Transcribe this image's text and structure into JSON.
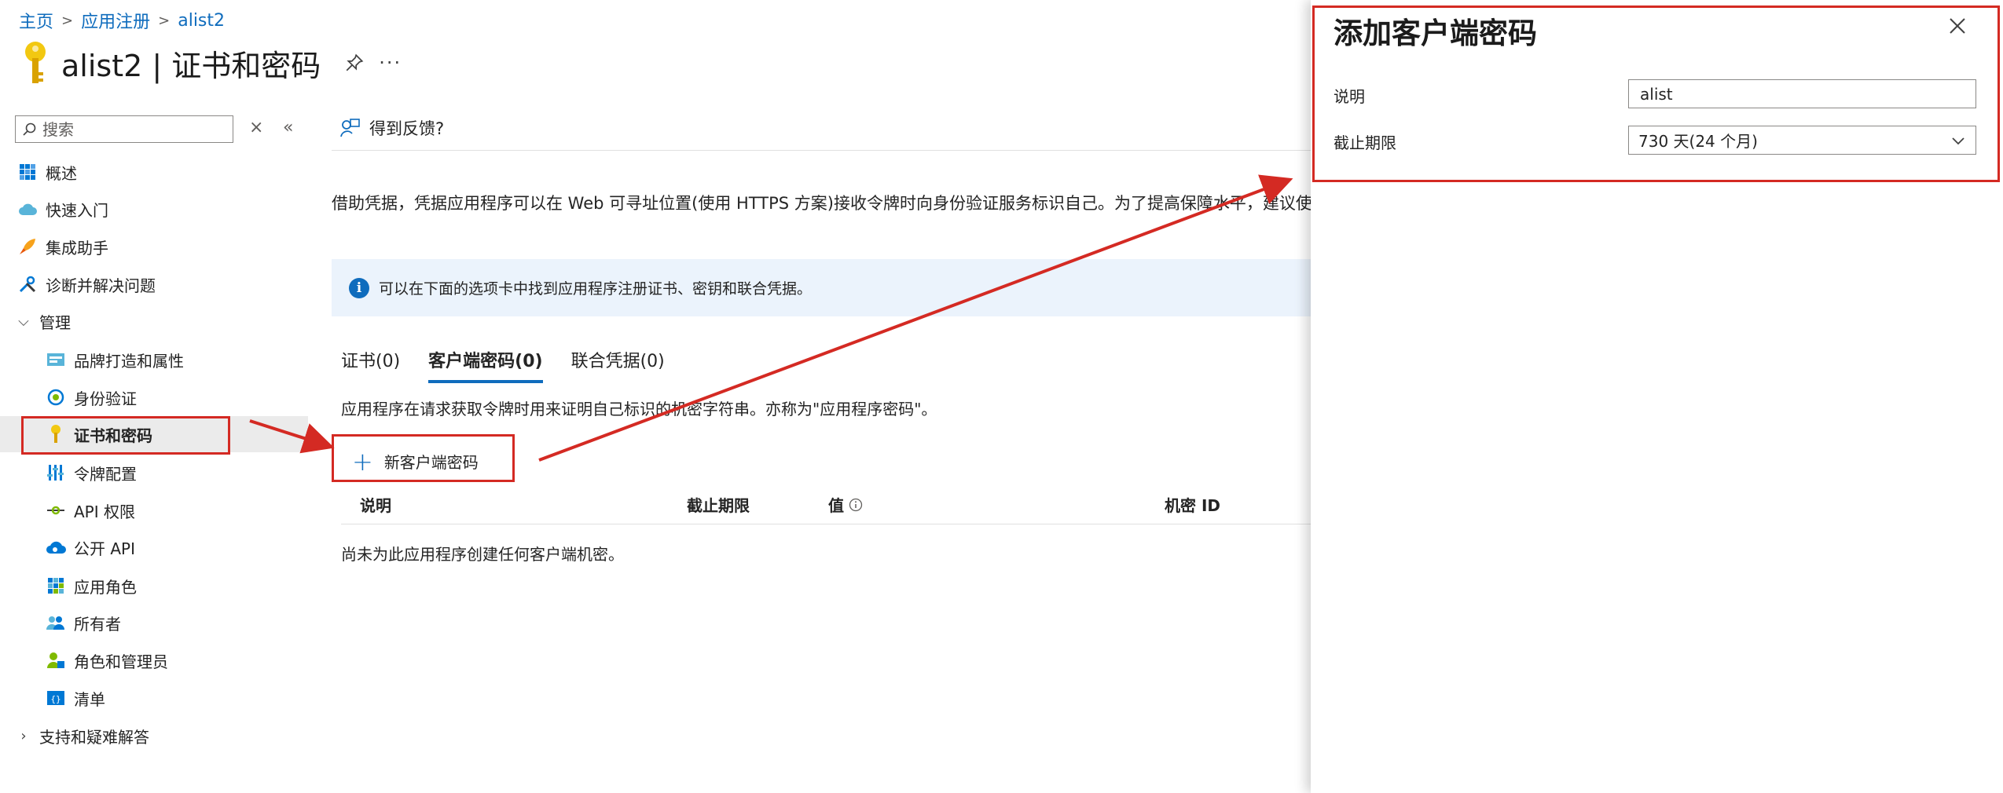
{
  "breadcrumb": [
    "主页",
    "应用注册",
    "alist2"
  ],
  "page": {
    "title": "alist2 | 证书和密码"
  },
  "sidebar": {
    "search_placeholder": "搜索",
    "items": [
      {
        "label": "概述",
        "icon": "grid-icon"
      },
      {
        "label": "快速入门",
        "icon": "cloud-rocket-icon"
      },
      {
        "label": "集成助手",
        "icon": "rocket-icon"
      },
      {
        "label": "诊断并解决问题",
        "icon": "wrench-icon"
      },
      {
        "label": "管理",
        "icon": "chevron-down-icon"
      },
      {
        "label": "品牌打造和属性",
        "icon": "card-icon"
      },
      {
        "label": "身份验证",
        "icon": "auth-icon"
      },
      {
        "label": "证书和密码",
        "icon": "key-icon"
      },
      {
        "label": "令牌配置",
        "icon": "bars-icon"
      },
      {
        "label": "API 权限",
        "icon": "api-icon"
      },
      {
        "label": "公开 API",
        "icon": "cloud-icon"
      },
      {
        "label": "应用角色",
        "icon": "apps-icon"
      },
      {
        "label": "所有者",
        "icon": "people-icon"
      },
      {
        "label": "角色和管理员",
        "icon": "user-admin-icon"
      },
      {
        "label": "清单",
        "icon": "manifest-icon"
      },
      {
        "label": "支持和疑难解答",
        "icon": "chevron-right-icon"
      }
    ]
  },
  "main": {
    "feedback": "得到反馈?",
    "description": "借助凭据，凭据应用程序可以在 Web 可寻址位置(使用 HTTPS 方案)接收令牌时向身份验证服务标识自己。为了提高保障水平，建议使用证书(而不",
    "info": "可以在下面的选项卡中找到应用程序注册证书、密钥和联合凭据。",
    "tabs": [
      {
        "label": "证书(0)"
      },
      {
        "label": "客户端密码(0)"
      },
      {
        "label": "联合凭据(0)"
      }
    ],
    "tab_description": "应用程序在请求获取令牌时用来证明自己标识的机密字符串。亦称为\"应用程序密码\"。",
    "new_secret": "新客户端密码",
    "table": {
      "headers": [
        "说明",
        "截止期限",
        "值",
        "机密 ID"
      ],
      "empty": "尚未为此应用程序创建任何客户端机密。"
    }
  },
  "panel": {
    "title": "添加客户端密码",
    "desc_label": "说明",
    "desc_value": "alist",
    "expiry_label": "截止期限",
    "expiry_value": "730 天(24 个月)"
  },
  "colors": {
    "accent": "#0f6cbd",
    "annotation_red": "#d42a23",
    "info_bg": "#ebf3fc",
    "active_bg": "#ebebeb"
  }
}
